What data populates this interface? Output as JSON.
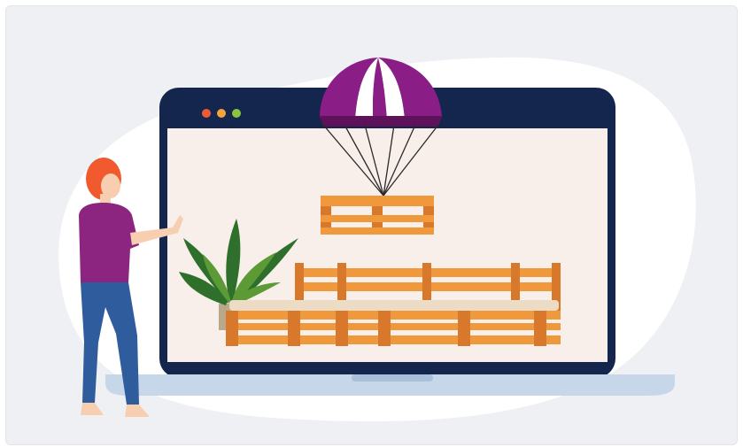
{
  "illustration": {
    "colors": {
      "background": "#eff0f4",
      "blob": "#ffffff",
      "laptop_bezel": "#14264d",
      "screen": "#f8efea",
      "laptop_base": "#c6d7ea",
      "parachute_purple": "#8b1d86",
      "parachute_white": "#ffffff",
      "wood": "#f0983c",
      "wood_dark": "#d8782a",
      "cushion": "#eddcc5",
      "plant": "#2f6f2c",
      "person_hair": "#f15a2f",
      "person_shirt": "#8b257f",
      "person_pants": "#2f5c9c",
      "skin": "#f7cfb0"
    },
    "window_dots": [
      "#f05a35",
      "#f6a23a",
      "#8bc53f"
    ],
    "icons": [
      "parachute-icon",
      "pallet-icon",
      "pallet-sofa-icon",
      "palm-plant-icon",
      "person-icon",
      "laptop-icon"
    ]
  }
}
